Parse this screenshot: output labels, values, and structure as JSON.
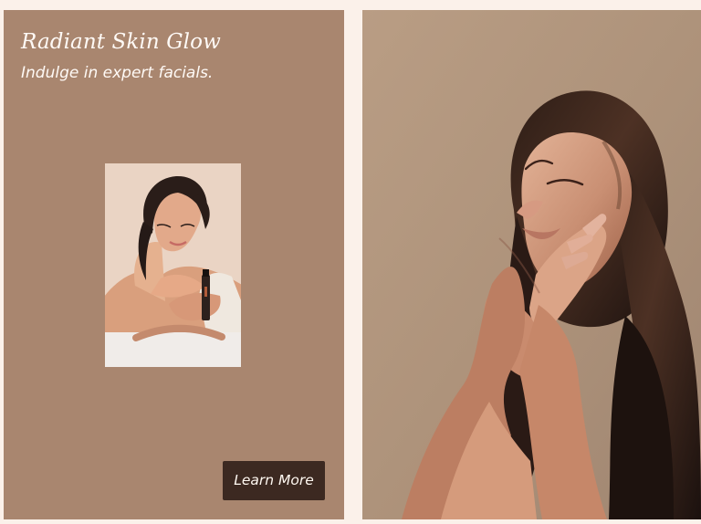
{
  "promo": {
    "title": "Radiant Skin Glow",
    "subtitle": "Indulge in expert facials.",
    "button_label": "Learn More",
    "colors": {
      "page_background": "#fbf1ea",
      "left_panel": "#a9866f",
      "button_background": "#3c2921",
      "button_text": "#fff8f1",
      "heading_text": "#fffaf6"
    }
  }
}
